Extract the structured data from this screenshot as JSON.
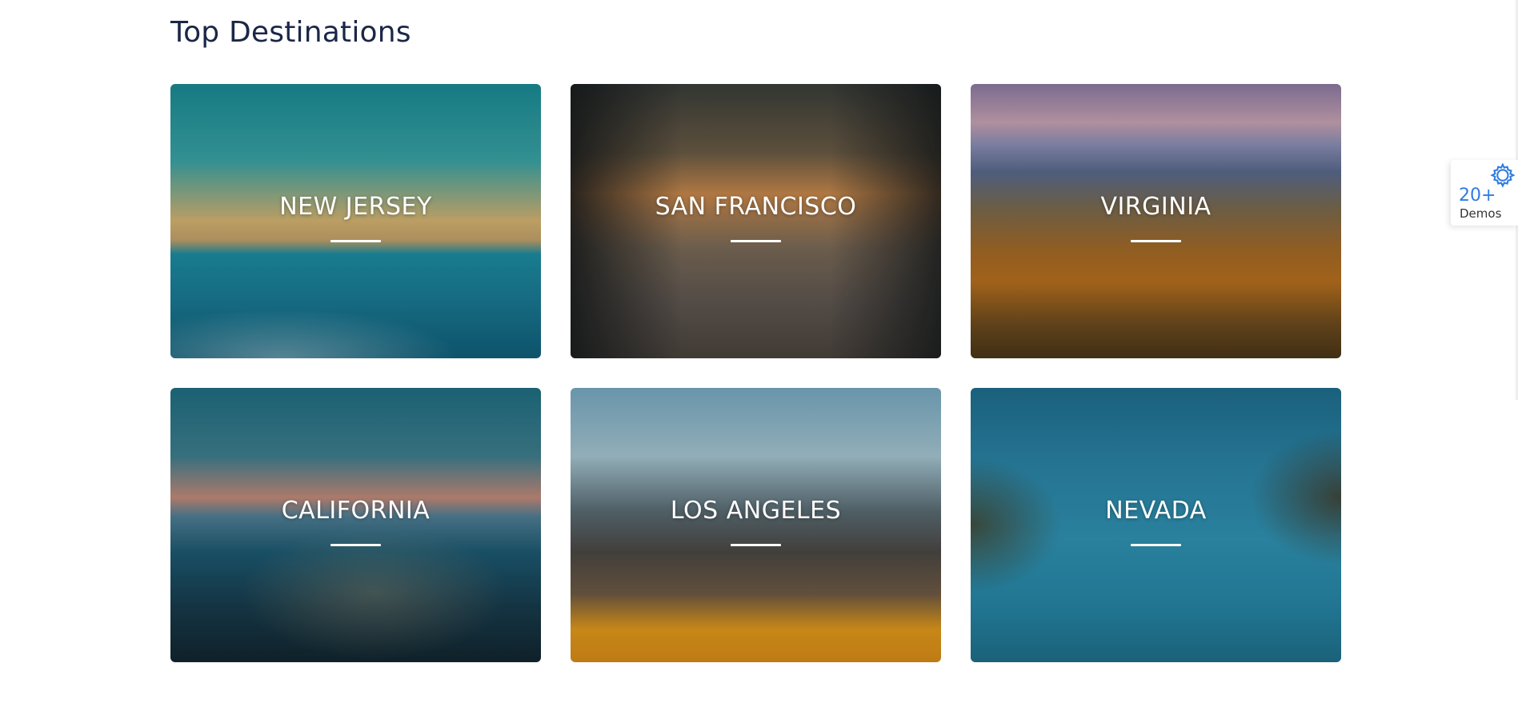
{
  "section": {
    "title": "Top Destinations"
  },
  "destinations": [
    {
      "name": "NEW JERSEY"
    },
    {
      "name": "SAN FRANCISCO"
    },
    {
      "name": "VIRGINIA"
    },
    {
      "name": "CALIFORNIA"
    },
    {
      "name": "LOS ANGELES"
    },
    {
      "name": "NEVADA"
    }
  ],
  "demos_widget": {
    "count": "20+",
    "label": "Demos",
    "icon": "gear-icon",
    "accent": "#2f7ce0"
  }
}
